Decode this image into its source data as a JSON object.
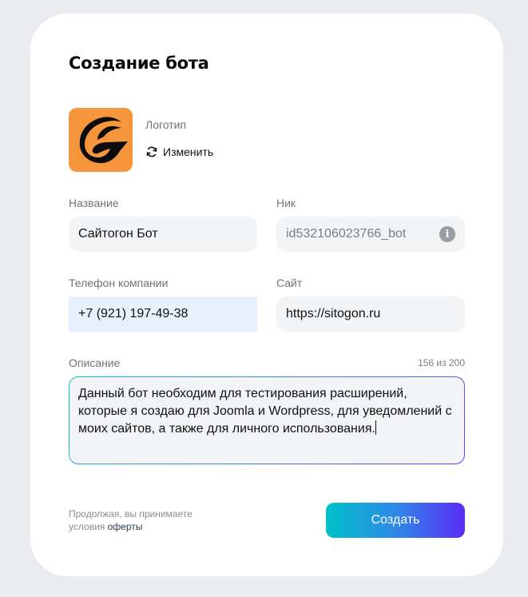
{
  "form": {
    "title": "Создание бота",
    "logo": {
      "label": "Логотип",
      "change_label": "Изменить",
      "background_color": "#f6963c"
    },
    "name": {
      "label": "Название",
      "value": "Сайтогон Бот"
    },
    "nick": {
      "label": "Ник",
      "value": "id532106023766_bot",
      "info_icon": "info-icon"
    },
    "phone": {
      "label": "Телефон компании",
      "value": "+7 (921) 197-49-38"
    },
    "site": {
      "label": "Сайт",
      "value": "https://sitogon.ru"
    },
    "description": {
      "label": "Описание",
      "counter": "156 из 200",
      "value": "Данный бот необходим для тестирования расширений, которые я создаю для Joomla и Wordpress, для уведомлений с моих сайтов, а также для личного использования."
    },
    "terms": {
      "text": "Продолжая, вы принимаете условия",
      "link": "оферты"
    },
    "submit_label": "Создать"
  },
  "colors": {
    "background": "#ebecef",
    "field_bg": "#f3f4f6",
    "focused_field_bg": "#e7f1fd",
    "button_gradient_start": "#00c2c9",
    "button_gradient_end": "#5b2cf6"
  }
}
